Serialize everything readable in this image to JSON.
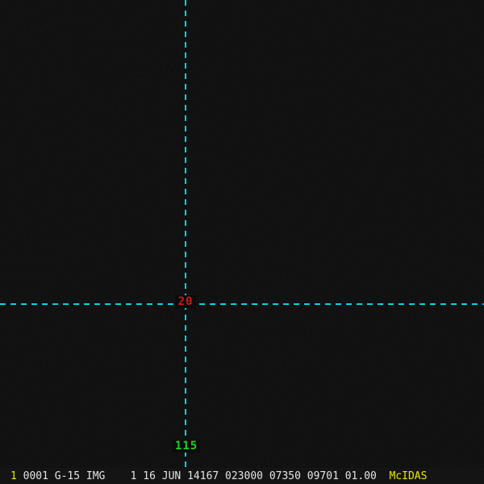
{
  "colors": {
    "bg": "#0b0b0b",
    "bar_bg": "#141414",
    "cyan": "#00d4e4",
    "red": "#d81414",
    "green": "#1fd21f",
    "text": "#e4e4e4",
    "yellow": "#e8e800"
  },
  "crosshair": {
    "latitude_label": "20",
    "longitude_label": "115"
  },
  "status_bar": {
    "frame": "1",
    "position": "0001",
    "sensor": "G-15",
    "type": "IMG",
    "band": "1",
    "date": "16 JUN 14167",
    "time": "023000",
    "line": "07350",
    "element": "09701",
    "magnification": "01.00",
    "brand": "McIDAS"
  }
}
